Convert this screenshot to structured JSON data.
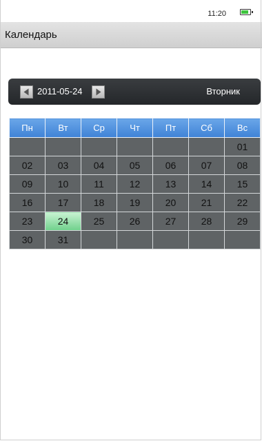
{
  "status": {
    "time": "11:20",
    "battery_icon": "battery-icon",
    "battery_level": 0.9
  },
  "app": {
    "title": "Календарь"
  },
  "nav": {
    "date": "2011-05-24",
    "weekday": "Вторник",
    "prev_icon": "arrow-left-icon",
    "next_icon": "arrow-right-icon"
  },
  "calendar": {
    "weekdays": [
      "Пн",
      "Вт",
      "Ср",
      "Чт",
      "Пт",
      "Сб",
      "Вс"
    ],
    "weeks": [
      [
        "",
        "",
        "",
        "",
        "",
        "",
        "01"
      ],
      [
        "02",
        "03",
        "04",
        "05",
        "06",
        "07",
        "08"
      ],
      [
        "09",
        "10",
        "11",
        "12",
        "13",
        "14",
        "15"
      ],
      [
        "16",
        "17",
        "18",
        "19",
        "20",
        "21",
        "22"
      ],
      [
        "23",
        "24",
        "25",
        "26",
        "27",
        "28",
        "29"
      ],
      [
        "30",
        "31",
        "",
        "",
        "",
        "",
        ""
      ]
    ],
    "selected_day": "24"
  },
  "colors": {
    "header": "#4a8fde",
    "cell": "#5f6365",
    "selected": "#8fdca3",
    "navbar": "#2e3134"
  }
}
